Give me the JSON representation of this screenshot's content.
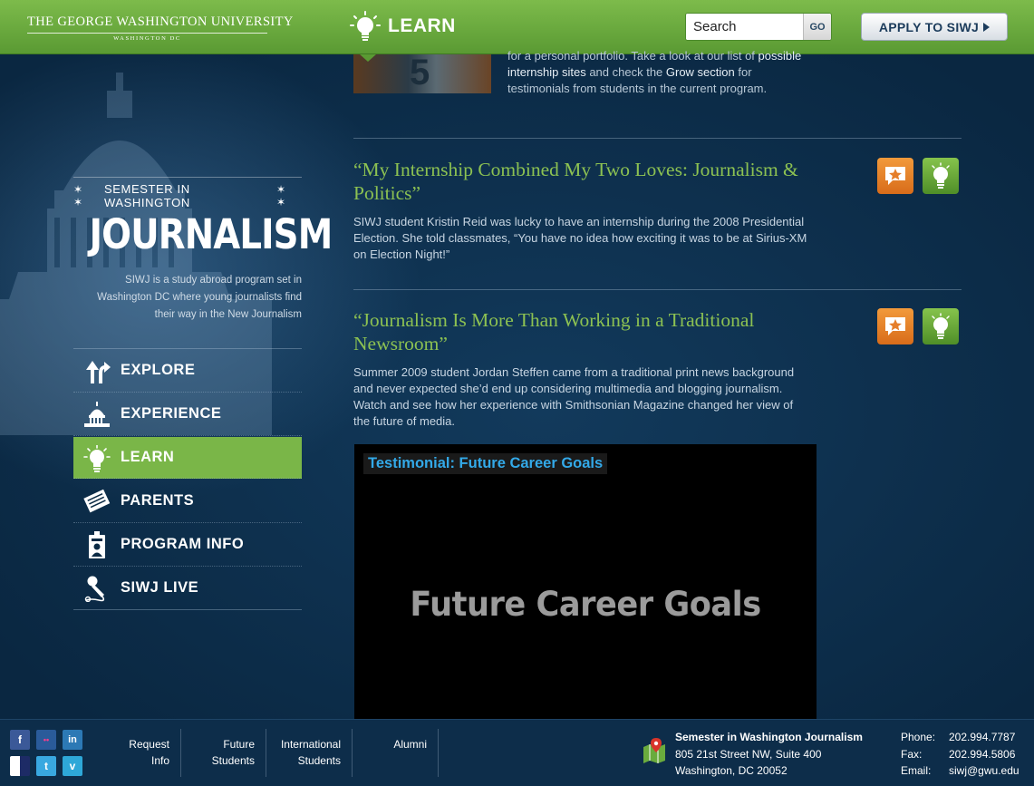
{
  "header": {
    "university_name": "THE GEORGE WASHINGTON UNIVERSITY",
    "university_sub": "WASHINGTON DC",
    "section_title": "LEARN",
    "search_placeholder": "Search",
    "search_button": "GO",
    "apply_button": "APPLY TO SIWJ"
  },
  "brand": {
    "top_line": "SEMESTER IN WASHINGTON",
    "title": "JOURNALISM",
    "description": "SIWJ is a study abroad program set in Washington DC where young journalists find their way in the New Journalism"
  },
  "nav": {
    "items": [
      {
        "label": "EXPLORE",
        "icon": "fork-arrows-icon",
        "active": false
      },
      {
        "label": "EXPERIENCE",
        "icon": "capitol-icon",
        "active": false
      },
      {
        "label": "LEARN",
        "icon": "lightbulb-icon",
        "active": true
      },
      {
        "label": "PARENTS",
        "icon": "newspaper-icon",
        "active": false
      },
      {
        "label": "PROGRAM INFO",
        "icon": "press-badge-icon",
        "active": false
      },
      {
        "label": "SIWJ LIVE",
        "icon": "microphone-icon",
        "active": false
      }
    ]
  },
  "main": {
    "intro": {
      "thumb_number": "5",
      "text_before": "for a personal portfolio. Take a look at our list of ",
      "link_sites": "possible internship sites",
      "text_middle": " and check the ",
      "link_grow": "Grow section",
      "text_after": " for testimonials from students in the current program."
    },
    "posts": [
      {
        "title": "“My Internship Combined My Two Loves: Journalism & Politics”",
        "body": "SIWJ student Kristin Reid was lucky to have an internship during the 2008 Presidential Election. She told classmates, “You have no idea how exciting it was to be at Sirius-XM on Election Night!”"
      },
      {
        "title": "“Journalism Is More Than Working in a Traditional Newsroom”",
        "body": "Summer 2009 student Jordan Steffen came from a traditional print news background and never expected she’d end up considering multimedia and blogging journalism. Watch and see how her experience with Smithsonian Magazine changed her view of the future of media."
      }
    ],
    "video": {
      "tag": "Testimonial: Future Career Goals",
      "title": "Future Career Goals"
    }
  },
  "footer": {
    "social": [
      "f",
      "••",
      "in",
      "",
      "t",
      "v"
    ],
    "links": [
      {
        "line1": "Request",
        "line2": "Info"
      },
      {
        "line1": "Future",
        "line2": "Students"
      },
      {
        "line1": "International",
        "line2": "Students"
      },
      {
        "line1": "Alumni",
        "line2": ""
      }
    ],
    "address": {
      "org": "Semester in Washington Journalism",
      "street": "805 21st Street NW, Suite 400",
      "city": "Washington, DC 20052"
    },
    "contact": {
      "phone_label": "Phone:",
      "phone": "202.994.7787",
      "fax_label": "Fax:",
      "fax": "202.994.5806",
      "email_label": "Email:",
      "email": "siwj@gwu.edu"
    }
  },
  "colors": {
    "header_green": "#6aab3d",
    "title_green": "#8cc152",
    "active_nav": "#7ab648",
    "badge_orange": "#e57e2a",
    "video_tag_blue": "#33a9e8"
  }
}
